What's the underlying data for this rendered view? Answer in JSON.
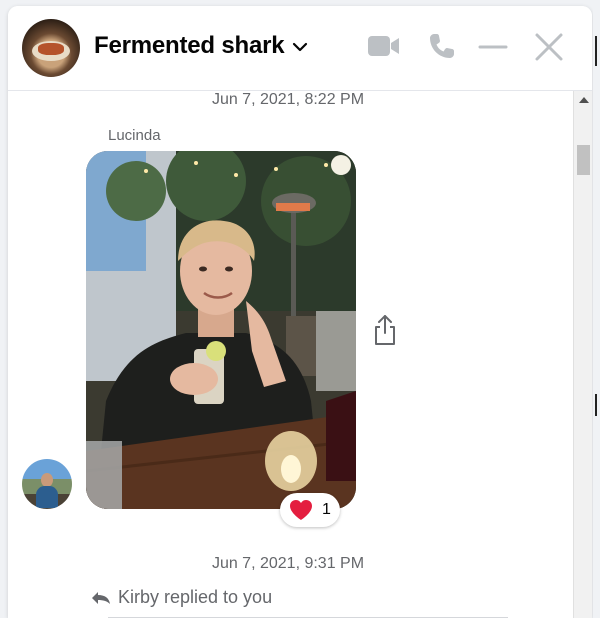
{
  "header": {
    "title": "Fermented shark",
    "icons": [
      "video-call-icon",
      "phone-call-icon",
      "minimize-icon",
      "close-icon"
    ]
  },
  "conversation": {
    "messages": [
      {
        "timestamp": "Jun 7, 2021, 8:22 PM",
        "sender": "Lucinda",
        "type": "photo",
        "reaction": {
          "emoji": "heart",
          "count": "1"
        }
      },
      {
        "timestamp": "Jun 7, 2021, 9:31 PM",
        "reply_notice": "Kirby replied to you"
      }
    ]
  },
  "colors": {
    "text_primary": "#050505",
    "text_secondary": "#65676b",
    "icon_gray": "#bcc0c4",
    "heart": "#e41e3f"
  }
}
